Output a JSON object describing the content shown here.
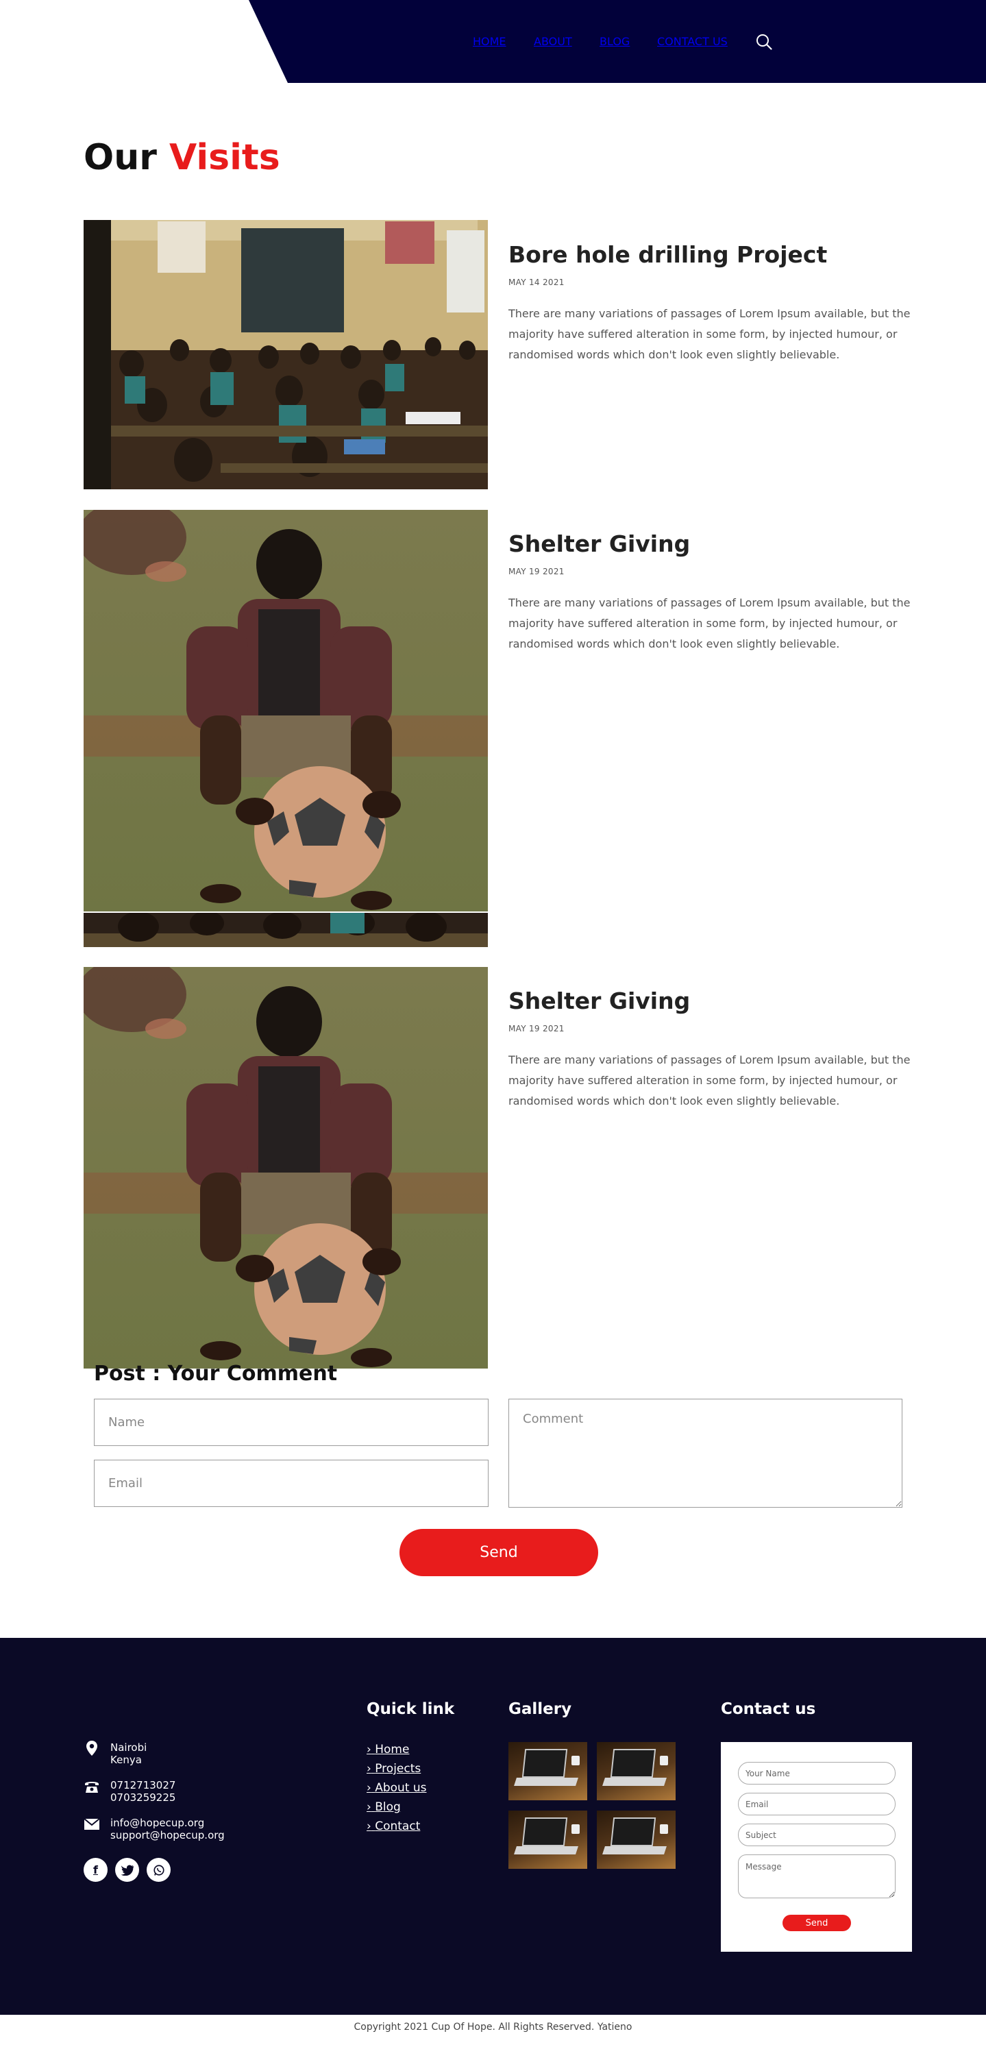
{
  "nav": {
    "items": [
      {
        "label": "HOME",
        "active": false
      },
      {
        "label": "ABOUT",
        "active": false
      },
      {
        "label": "BLOG",
        "active": true
      },
      {
        "label": "CONTACT US",
        "active": false
      }
    ],
    "search_icon": "search-icon"
  },
  "page": {
    "title_part1": "Our",
    "title_part2": "Visits"
  },
  "posts": [
    {
      "title": "Bore hole drilling Project",
      "date": "MAY 14 2021",
      "body": "There are many variations of passages of Lorem Ipsum available, but the majority have suffered alteration in some form, by injected humour, or randomised words which don't look even slightly believable.",
      "image": "classroom-photo"
    },
    {
      "title": "Shelter Giving",
      "date": "MAY 19 2021",
      "body": "There are many variations of passages of Lorem Ipsum available, but the majority have suffered alteration in some form, by injected humour, or randomised words which don't look even slightly believable.",
      "image": "boy-with-ball-photo"
    },
    {
      "title": "Shelter Giving",
      "date": "MAY 19 2021",
      "body": "There are many variations of passages of Lorem Ipsum available, but the majority have suffered alteration in some form, by injected humour, or randomised words which don't look even slightly believable.",
      "image": "boy-with-ball-photo"
    }
  ],
  "comment_form": {
    "heading": "Post : Your Comment",
    "name_placeholder": "Name",
    "email_placeholder": "Email",
    "comment_placeholder": "Comment",
    "send_label": "Send"
  },
  "footer": {
    "address_line1": "Nairobi",
    "address_line2": "Kenya",
    "phone1": "0712713027",
    "phone2": "0703259225",
    "email1": "info@hopecup.org",
    "email2": "support@hopecup.org",
    "social": [
      "facebook-icon",
      "twitter-icon",
      "whatsapp-icon"
    ],
    "quick_links_title": "Quick link",
    "quick_links": [
      "Home",
      "Projects",
      "About us",
      "Blog",
      "Contact"
    ],
    "gallery_title": "Gallery",
    "contact_title": "Contact us",
    "contact_form": {
      "name_placeholder": "Your Name",
      "email_placeholder": "Email",
      "subject_placeholder": "Subject",
      "message_placeholder": "Message",
      "send_label": "Send"
    },
    "copyright": "Copyright 2021 Cup Of Hope. All Rights Reserved. Yatieno"
  },
  "colors": {
    "navy": "#02013a",
    "footer_bg": "#0b0a26",
    "accent_red": "#e81c1c"
  }
}
